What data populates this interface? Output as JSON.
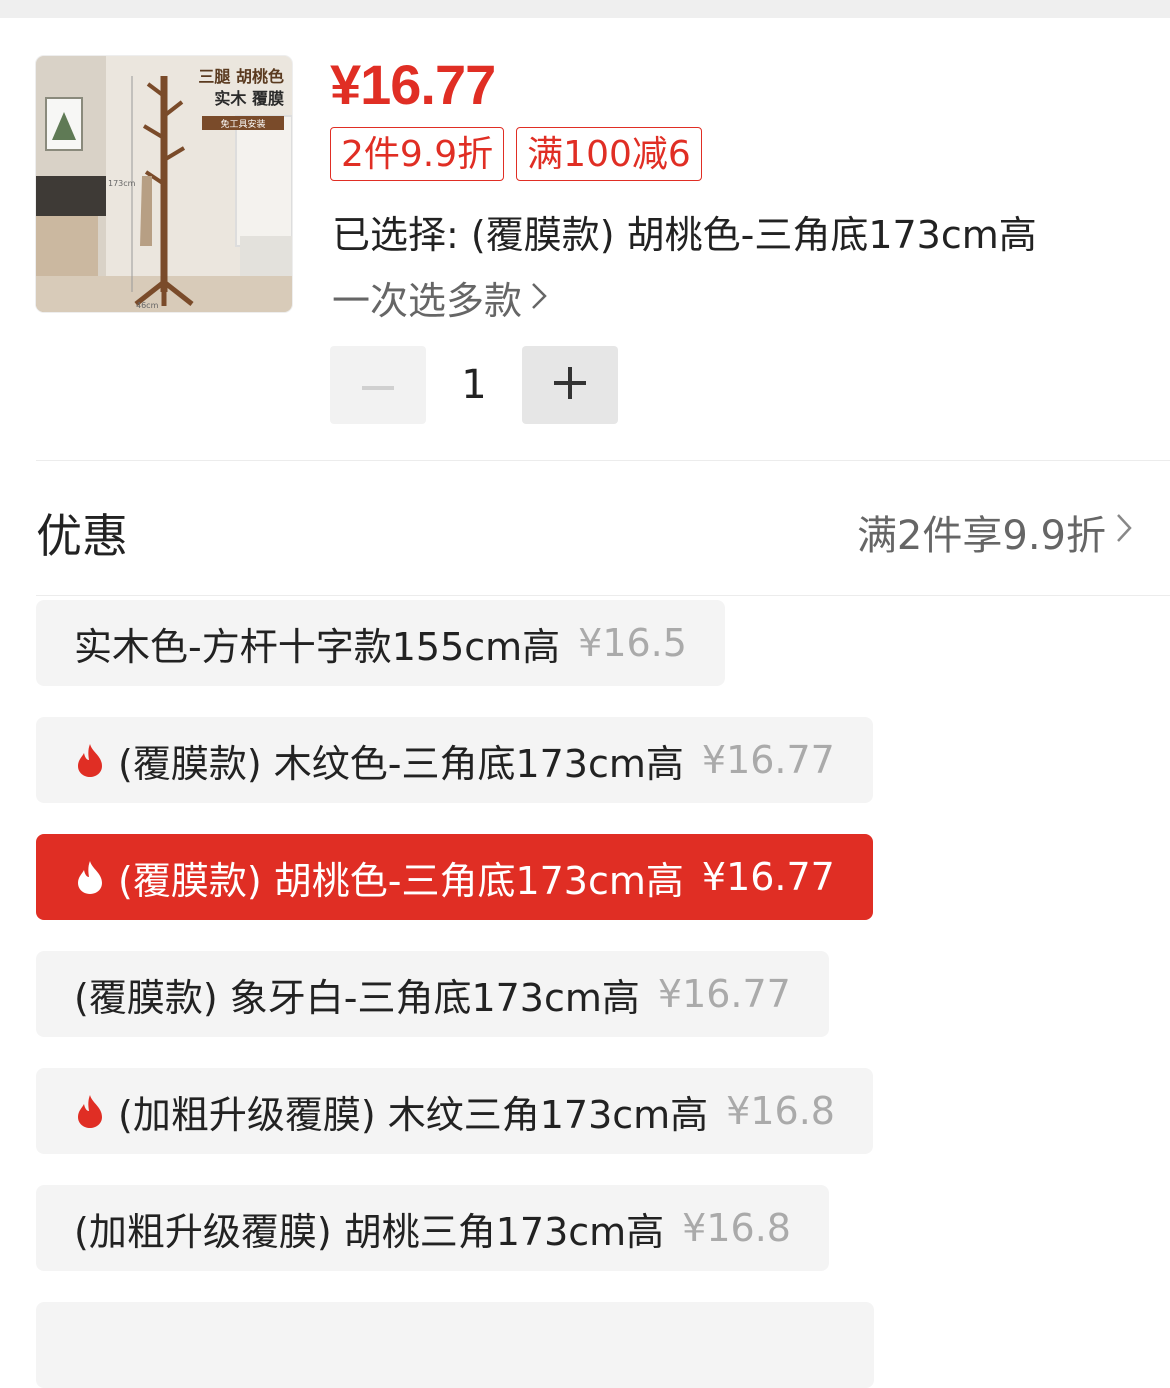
{
  "product": {
    "thumbnail_text_line1": "三腿 胡桃色",
    "thumbnail_text_line2": "实木 覆膜",
    "thumbnail_badge": "免工具安装",
    "thumbnail_height_label": "173cm",
    "thumbnail_width_label": "46cm",
    "price": "¥16.77",
    "tags": [
      "2件9.9折",
      "满100减6"
    ],
    "selected_text": "已选择: (覆膜款) 胡桃色-三角底173cm高",
    "multi_select_text": "一次选多款",
    "quantity": "1"
  },
  "promo": {
    "label": "优惠",
    "detail": "满2件享9.9折"
  },
  "options": [
    {
      "name": "实木色-方杆十字款155cm高",
      "price": "¥16.5",
      "hot": false,
      "active": false
    },
    {
      "name": "(覆膜款) 木纹色-三角底173cm高",
      "price": "¥16.77",
      "hot": true,
      "active": false
    },
    {
      "name": "(覆膜款) 胡桃色-三角底173cm高",
      "price": "¥16.77",
      "hot": true,
      "active": true
    },
    {
      "name": "(覆膜款) 象牙白-三角底173cm高",
      "price": "¥16.77",
      "hot": false,
      "active": false
    },
    {
      "name": "(加粗升级覆膜) 木纹三角173cm高",
      "price": "¥16.8",
      "hot": true,
      "active": false
    },
    {
      "name": "(加粗升级覆膜) 胡桃三角173cm高",
      "price": "¥16.8",
      "hot": false,
      "active": false
    }
  ],
  "colors": {
    "accent": "#e02e24",
    "chip_bg": "#f4f4f4"
  },
  "icons": {
    "minus": "minus-icon",
    "plus": "plus-icon",
    "chevron": "chevron-right-icon",
    "hot": "fire-icon"
  }
}
